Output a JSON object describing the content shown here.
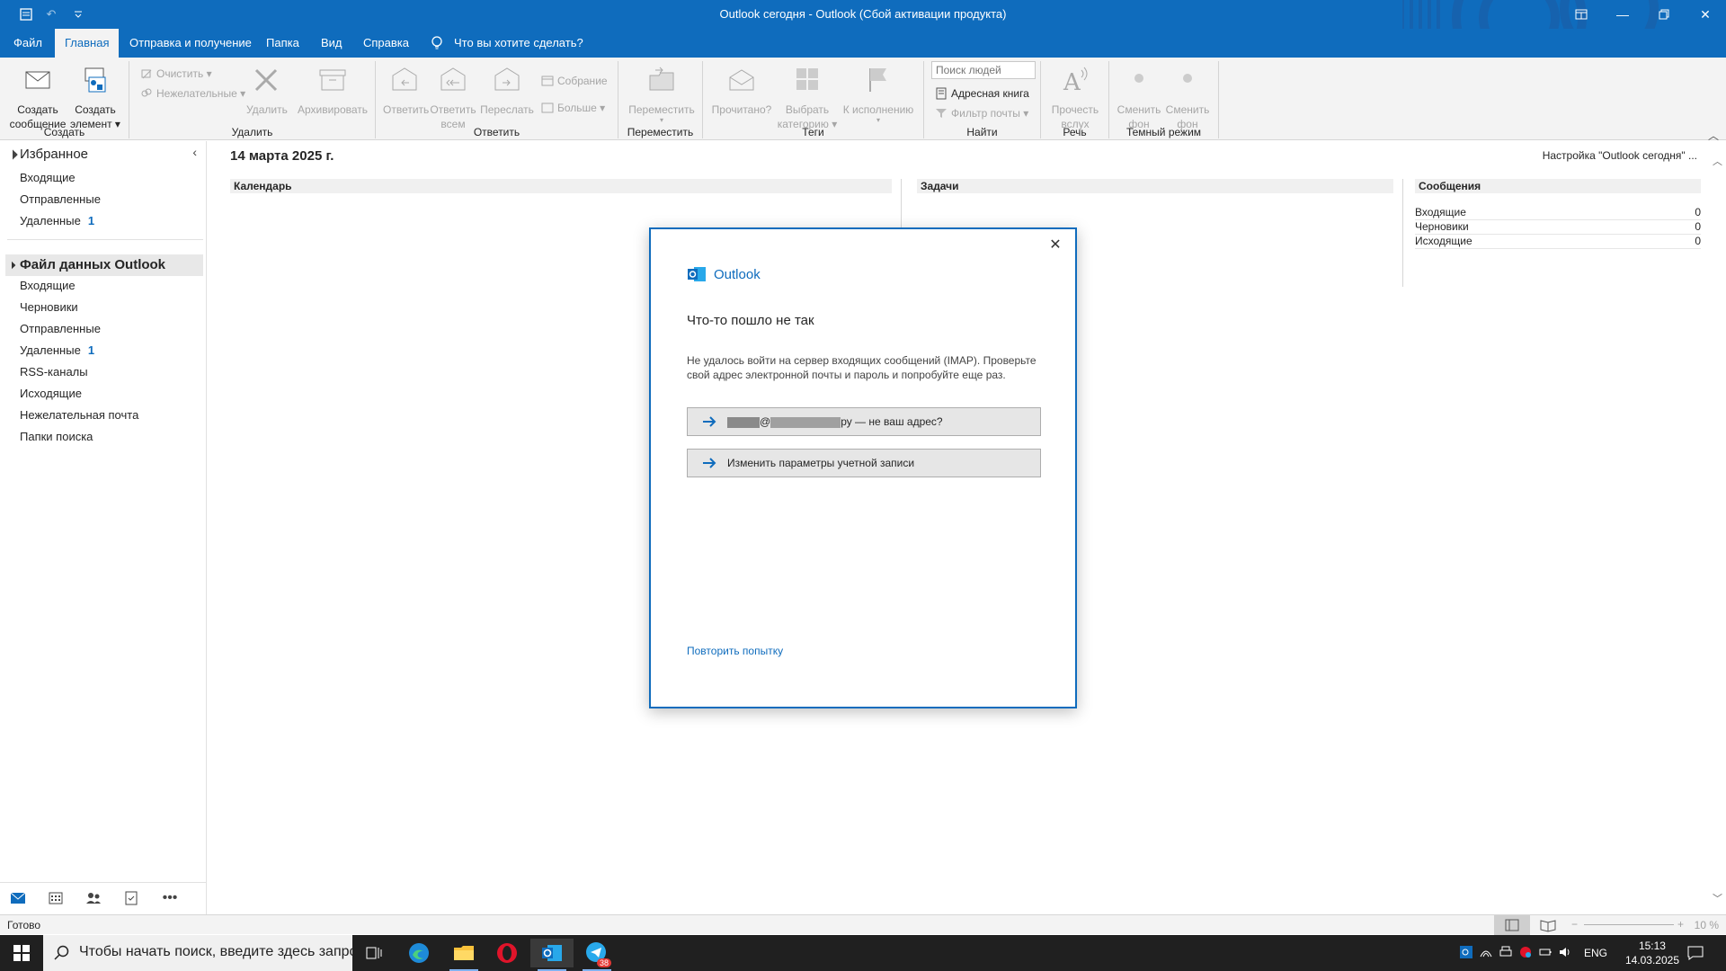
{
  "window": {
    "title": "Outlook сегодня  -  Outlook (Сбой активации продукта)"
  },
  "tabs": [
    {
      "label": "Файл",
      "active": false
    },
    {
      "label": "Главная",
      "active": true
    },
    {
      "label": "Отправка и получение",
      "active": false
    },
    {
      "label": "Папка",
      "active": false
    },
    {
      "label": "Вид",
      "active": false
    },
    {
      "label": "Справка",
      "active": false
    }
  ],
  "tell_me": "Что вы хотите сделать?",
  "ribbon": {
    "groups": {
      "create": "Создать",
      "delete": "Удалить",
      "reply": "Ответить",
      "move": "Переместить",
      "tags": "Теги",
      "find": "Найти",
      "speech": "Речь",
      "dark": "Темный режим"
    },
    "new_message": [
      "Создать",
      "сообщение"
    ],
    "new_item": [
      "Создать",
      "элемент ▾"
    ],
    "clean": "Очистить ▾",
    "junk": "Нежелательные ▾",
    "delete_btn": "Удалить",
    "archive": "Архивировать",
    "reply_btn": "Ответить",
    "reply_all": [
      "Ответить",
      "всем"
    ],
    "forward": "Переслать",
    "meeting": "Собрание",
    "more": "Больше ▾",
    "move_btn": [
      "Переместить",
      "▾"
    ],
    "read": "Прочитано?",
    "categorize": [
      "Выбрать",
      "категорию ▾"
    ],
    "followup": [
      "К исполнению",
      "▾"
    ],
    "people_search": "Поиск людей",
    "address_book": "Адресная книга",
    "filter_mail": "Фильтр почты ▾",
    "read_aloud": [
      "Прочесть",
      "вслух"
    ],
    "switch_bg_1": [
      "Сменить",
      "фон"
    ],
    "switch_bg_2": [
      "Сменить",
      "фон"
    ]
  },
  "nav": {
    "favorites_header": "Избранное",
    "favorites": [
      {
        "label": "Входящие",
        "count": ""
      },
      {
        "label": "Отправленные",
        "count": ""
      },
      {
        "label": "Удаленные",
        "count": "1"
      }
    ],
    "datafile_header": "Файл данных Outlook",
    "folders": [
      {
        "label": "Входящие",
        "count": ""
      },
      {
        "label": "Черновики",
        "count": ""
      },
      {
        "label": "Отправленные",
        "count": ""
      },
      {
        "label": "Удаленные",
        "count": "1"
      },
      {
        "label": "RSS-каналы",
        "count": ""
      },
      {
        "label": "Исходящие",
        "count": ""
      },
      {
        "label": "Нежелательная почта",
        "count": ""
      },
      {
        "label": "Папки поиска",
        "count": ""
      }
    ]
  },
  "today": {
    "date": "14 марта 2025 г.",
    "settings": "Настройка \"Outlook сегодня\" ...",
    "calendar": "Календарь",
    "tasks": "Задачи",
    "messages": "Сообщения",
    "message_rows": [
      {
        "label": "Входящие",
        "value": "0"
      },
      {
        "label": "Черновики",
        "value": "0"
      },
      {
        "label": "Исходящие",
        "value": "0"
      }
    ]
  },
  "status": {
    "text": "Готово",
    "zoom": "10 %"
  },
  "dialog": {
    "brand": "Outlook",
    "title": "Что-то пошло не так",
    "message": "Не удалось войти на сервер входящих сообщений (IMAP). Проверьте свой адрес электронной почты и пароль и попробуйте еще раз.",
    "not_your_address_sep": "@",
    "not_your_address_suffix": "ру — не ваш адрес?",
    "change_settings": "Изменить параметры учетной записи",
    "retry": "Повторить попытку"
  },
  "taskbar": {
    "search_placeholder": "Чтобы начать поиск, введите здесь запрос",
    "lang": "ENG",
    "time": "15:13",
    "date": "14.03.2025",
    "telegram_badge": "38"
  },
  "colors": {
    "accent": "#0f6cbd",
    "taskbar": "#202020"
  }
}
